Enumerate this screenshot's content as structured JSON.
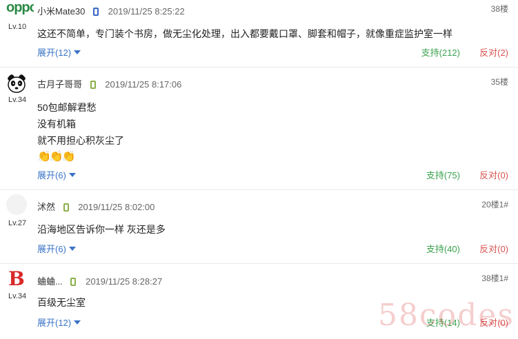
{
  "comments": [
    {
      "user": "小米Mate30",
      "level": "Lv.10",
      "time": "2019/11/25 8:25:22",
      "floor": "38楼",
      "lines": [
        "这还不简单，专门装个书房，做无尘化处理，出入都要戴口罩、脚套和帽子，就像重症监护室一样"
      ],
      "expand": "展开(12)",
      "support": "支持(212)",
      "oppose": "反对(2)",
      "avatar": "oppo-logo",
      "device_icon": "phone-icon-blue"
    },
    {
      "user": "古月子哥哥",
      "level": "Lv.34",
      "time": "2019/11/25 8:17:06",
      "floor": "35楼",
      "lines": [
        "50包邮解君愁",
        "没有机箱",
        "就不用担心积灰尘了"
      ],
      "emoji": "👏👏👏",
      "expand": "展开(6)",
      "support": "支持(75)",
      "oppose": "反对(0)",
      "avatar": "panda-avatar",
      "device_icon": "phone-icon-green"
    },
    {
      "user": "沭然",
      "level": "Lv.27",
      "time": "2019/11/25 8:02:00",
      "floor": "20楼1#",
      "lines": [
        "沿海地区告诉你一样 灰还是多"
      ],
      "expand": "展开(6)",
      "support": "支持(40)",
      "oppose": "反对(0)",
      "avatar": "blank-avatar",
      "device_icon": "phone-icon-green"
    },
    {
      "user": "蛐蛐...",
      "level": "Lv.34",
      "time": "2019/11/25 8:28:27",
      "floor": "38楼1#",
      "lines": [
        "百级无尘室"
      ],
      "expand": "展开(12)",
      "support": "支持(14)",
      "oppose": "反对(0)",
      "avatar": "b-letter-avatar",
      "device_icon": "phone-icon-green"
    }
  ],
  "avatar_texts": {
    "oppo": "oppo",
    "b": "B"
  },
  "watermark": "58codes",
  "colors": {
    "link_blue": "#3a73c6",
    "support_green": "#3aa24e",
    "oppose_red": "#d9534f"
  }
}
